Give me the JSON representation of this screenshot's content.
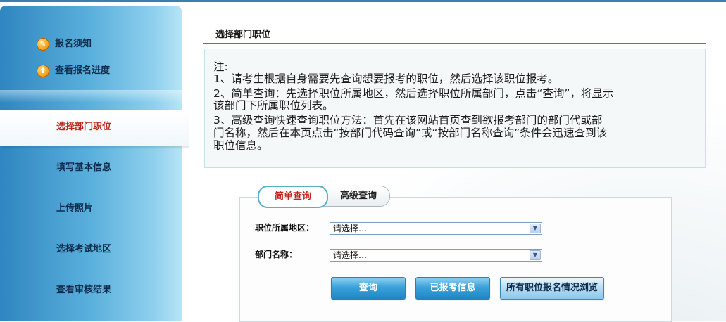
{
  "sidebar": {
    "top_items": [
      {
        "label": "报名须知",
        "icon": "edit-icon"
      },
      {
        "label": "查看报名进度",
        "icon": "progress-icon"
      }
    ],
    "steps": [
      {
        "label": "选择部门职位",
        "active": true
      },
      {
        "label": "填写基本信息",
        "active": false
      },
      {
        "label": "上传照片",
        "active": false
      },
      {
        "label": "选择考试地区",
        "active": false
      },
      {
        "label": "查看审核结果",
        "active": false
      }
    ]
  },
  "main": {
    "title": "选择部门职位",
    "notice": [
      "注:",
      "1、请考生根据自身需要先查询想要报考的职位，然后选择该职位报考。",
      "2、简单查询：先选择职位所属地区，然后选择职位所属部门，点击“查询”，将显示",
      "该部门下所属职位列表。",
      "3、高级查询快速查询职位方法：首先在该网站首页查到欲报考部门的部门代或部",
      "门名称，然后在本页点击“按部门代码查询”或“按部门名称查询”条件会迅速查到该",
      "职位信息。"
    ],
    "tabs": [
      {
        "label": "简单查询",
        "active": true
      },
      {
        "label": "高级查询",
        "active": false
      }
    ],
    "form": {
      "region_label": "职位所属地区：",
      "region_value": "请选择…",
      "dept_label": "部门名称：",
      "dept_value": "请选择…"
    },
    "buttons": {
      "query": "查询",
      "registered": "已报考信息",
      "browse_all": "所有职位报名情况浏览"
    }
  },
  "colors": {
    "accent": "#2f86c0",
    "active_text": "#c0251b",
    "rule": "#3d7fa6"
  }
}
